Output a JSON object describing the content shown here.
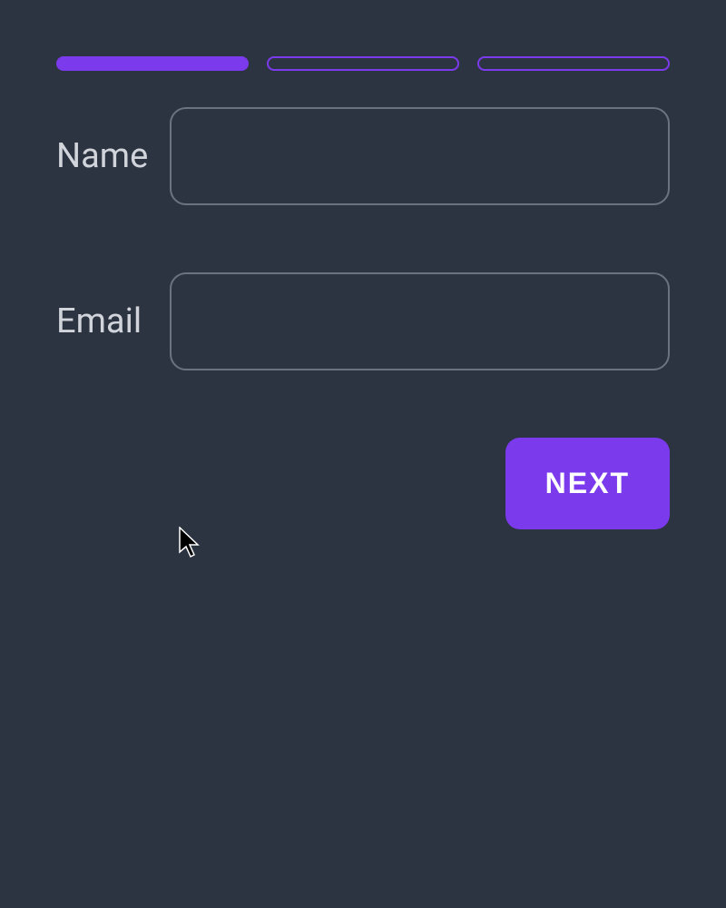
{
  "progress": {
    "total_steps": 3,
    "current_step": 1
  },
  "form": {
    "fields": {
      "name": {
        "label": "Name",
        "value": ""
      },
      "email": {
        "label": "Email",
        "value": ""
      }
    }
  },
  "buttons": {
    "next_label": "NEXT"
  },
  "colors": {
    "background": "#2d3441",
    "accent": "#7c3aed",
    "text": "#d1d5db",
    "border": "#6b7280"
  }
}
